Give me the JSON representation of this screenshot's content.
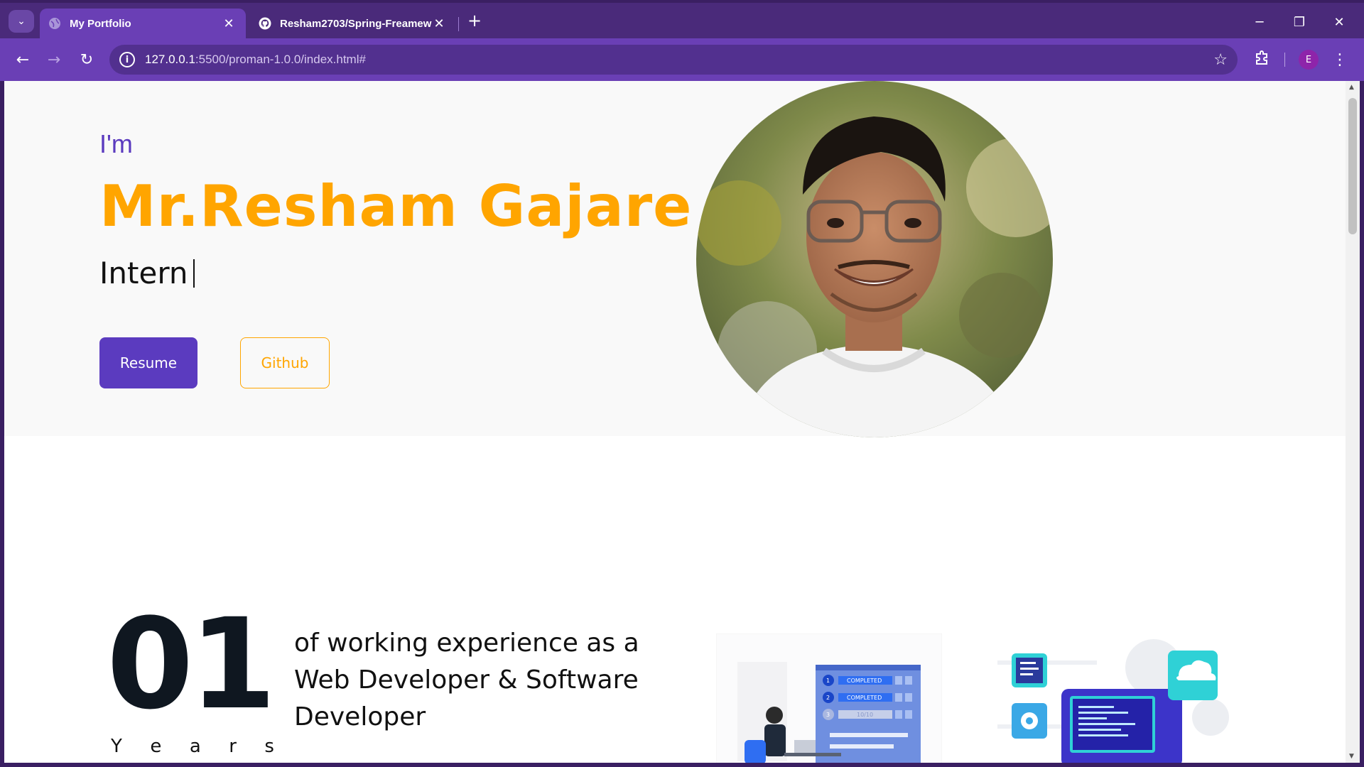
{
  "browser": {
    "tabs": [
      {
        "title": "My Portfolio",
        "active": true
      },
      {
        "title": "Resham2703/Spring-Freamew",
        "active": false
      }
    ],
    "address": {
      "host": "127.0.0.1",
      "path": ":5500/proman-1.0.0/index.html#"
    },
    "profile_initial": "E",
    "colors": {
      "frame": "#4a2a7a",
      "toolbar": "#6a3fb5"
    }
  },
  "hero": {
    "greeting": "I'm",
    "name": "Mr.Resham Gajare",
    "role": "Intern",
    "resume_label": "Resume",
    "github_label": "Github"
  },
  "experience": {
    "number": "01",
    "unit_letters": [
      "Y",
      "e",
      "a",
      "r",
      "s"
    ],
    "description": "of working experience as a Web Developer & Software Developer"
  },
  "illustration": {
    "status_labels": [
      "COMPLETED",
      "COMPLETED",
      "10/10"
    ]
  },
  "colors": {
    "accent_purple": "#5b3bbf",
    "accent_orange": "#ffa500"
  }
}
